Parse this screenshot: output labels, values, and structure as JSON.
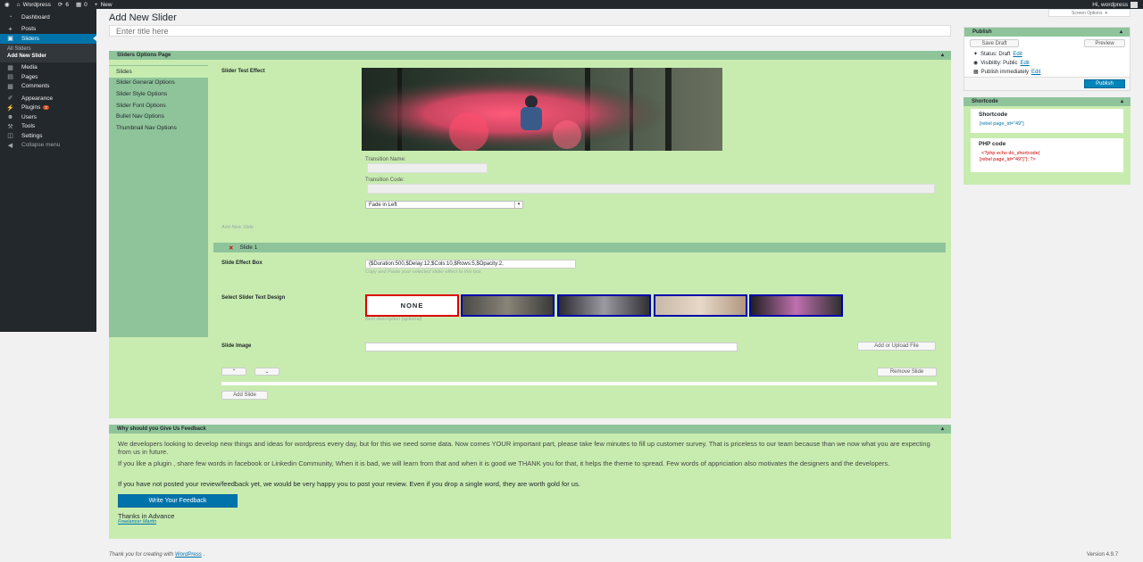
{
  "admin_bar": {
    "site_name": "Wordpress",
    "updates_count": "6",
    "comments_count": "0",
    "new_label": "New",
    "howdy": "Hi, wordpress"
  },
  "sidebar": {
    "items": [
      {
        "label": "Dashboard",
        "icon": "dashboard-icon"
      },
      {
        "label": "Posts",
        "icon": "pin-icon"
      },
      {
        "label": "Sliders",
        "icon": "slider-icon"
      },
      {
        "label": "Media",
        "icon": "media-icon"
      },
      {
        "label": "Pages",
        "icon": "page-icon"
      },
      {
        "label": "Comments",
        "icon": "comment-icon"
      },
      {
        "label": "Appearance",
        "icon": "brush-icon"
      },
      {
        "label": "Plugins",
        "icon": "plug-icon",
        "badge": "2"
      },
      {
        "label": "Users",
        "icon": "users-icon"
      },
      {
        "label": "Tools",
        "icon": "wrench-icon"
      },
      {
        "label": "Settings",
        "icon": "settings-icon"
      },
      {
        "label": "Collapse menu",
        "icon": "collapse-icon"
      }
    ],
    "submenu": [
      "All Sliders",
      "Add New Slider"
    ]
  },
  "page": {
    "title": "Add New Slider",
    "screen_options": "Screen Options",
    "title_placeholder": "Enter title here"
  },
  "options_box": {
    "title": "Sliders Options Page",
    "tabs": [
      "Slides",
      "Slider General Options",
      "Slider Style Options",
      "Slider Font Options",
      "Bullet Nav Options",
      "Thumbnail Nav Options"
    ],
    "effect_label": "Slider Test Effect",
    "transition_name_label": "Transition Name:",
    "transition_code_label": "Transition Code:",
    "transition_select": "Fade in Left",
    "add_new_slide_hint": "Add New Slide",
    "slide_title": "Slide 1",
    "slide_effect_label": "Slide Effect Box",
    "slide_effect_value": "{$Duration:500,$Delay:12,$Cols:10,$Rows:5,$Opacity:2,",
    "slide_effect_hint": "Copy and Paste your selected slider effect to this box",
    "text_design_label": "Select Slider Text Design",
    "none_label": "NONE",
    "text_design_hint": "Best description (optional)",
    "slide_image_label": "Slide Image",
    "upload_button": "Add or Upload File",
    "remove_button": "Remove Slide",
    "add_slide_button": "Add Slide"
  },
  "feedback": {
    "title": "Why should you Give Us Feedback",
    "para1": "We developers looking to develop new things and ideas for wordpress every day, but for this we need some data. Now comes YOUR important part, please take few minutes to fill up customer survey. That is priceless to our team because than we now what you are expecting from us in future.",
    "para2": "If you like a plugin , share few words in facebook or Linkedin Community, When it is bad, we will learn from that and when it is good we THANK you for that, it helps the theme to spread. Few words of appriciation also motivates the designers and the developers.",
    "para3": "If you have not posted your review/feedback yet, we would be very happy you to post your review. Even if you drop a single word, they are worth gold for us.",
    "button": "Write Your Feedback",
    "thanks": "Thanks in Advance",
    "author": "Freelancer Martin"
  },
  "publish": {
    "title": "Publish",
    "save_draft": "Save Draft",
    "preview": "Preview",
    "status": "Status: Draft",
    "visibility": "Visibility: Public",
    "schedule": "Publish immediately",
    "edit": "Edit",
    "publish_button": "Publish"
  },
  "shortcode": {
    "title": "Shortcode",
    "shortcode_label": "Shortcode",
    "shortcode_value": "[rebel page_id=\"49\"]",
    "php_label": "PHP code",
    "php_line1": "<?php echo do_shortcode(",
    "php_line2": "[rebel page_id=\"49\"]\"); ?>"
  },
  "footer": {
    "thanks": "Thank you for creating with",
    "wp_link": "WordPress",
    "version": "Version 4.9.7"
  },
  "colors": {
    "accent": "#0073aa",
    "panel_bg": "#c8ecb0",
    "panel_header": "#8fc49b",
    "admin_dark": "#23282d"
  }
}
